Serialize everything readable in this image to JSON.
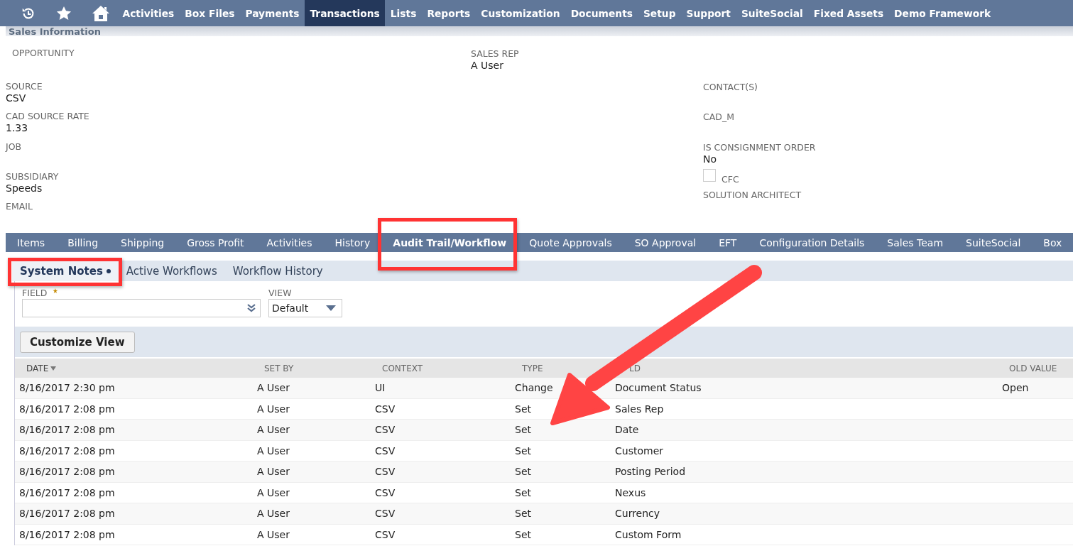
{
  "nav": {
    "icons": [
      {
        "kind": "history"
      },
      {
        "kind": "star"
      },
      {
        "kind": "home"
      }
    ],
    "items": [
      {
        "label": "Activities",
        "selected": false
      },
      {
        "label": "Box Files",
        "selected": false
      },
      {
        "label": "Payments",
        "selected": false
      },
      {
        "label": "Transactions",
        "selected": true
      },
      {
        "label": "Lists",
        "selected": false
      },
      {
        "label": "Reports",
        "selected": false
      },
      {
        "label": "Customization",
        "selected": false
      },
      {
        "label": "Documents",
        "selected": false
      },
      {
        "label": "Setup",
        "selected": false
      },
      {
        "label": "Support",
        "selected": false
      },
      {
        "label": "SuiteSocial",
        "selected": false
      },
      {
        "label": "Fixed Assets",
        "selected": false
      },
      {
        "label": "Demo Framework",
        "selected": false
      }
    ]
  },
  "section": {
    "title": "Sales Information"
  },
  "fields": {
    "column_1": [
      {
        "label": "OPPORTUNITY"
      },
      {
        "label": "SOURCE",
        "value": "CSV"
      },
      {
        "label": "CAD SOURCE RATE",
        "value": "1.33"
      },
      {
        "label": "JOB"
      },
      {
        "label": "SUBSIDIARY",
        "value": "Speeds"
      },
      {
        "label": "EMAIL"
      }
    ],
    "column_2": [
      {
        "label": "SALES REP",
        "value": "A User"
      }
    ],
    "column_3": [
      {
        "kind": "text",
        "label": "CONTACT(S)"
      },
      {
        "kind": "text",
        "label": "CAD_M"
      },
      {
        "kind": "text",
        "label": "IS CONSIGNMENT ORDER",
        "value": "No"
      },
      {
        "kind": "checkbox",
        "label": "CFC",
        "checked": false
      },
      {
        "kind": "text",
        "label": "SOLUTION ARCHITECT"
      }
    ]
  },
  "tabs": [
    {
      "label": "Items",
      "selected": false
    },
    {
      "label": "Billing",
      "selected": false
    },
    {
      "label": "Shipping",
      "selected": false
    },
    {
      "label": "Gross Profit",
      "selected": false
    },
    {
      "label": "Activities",
      "selected": false
    },
    {
      "label": "History",
      "selected": false
    },
    {
      "label": "Audit Trail/Workflow",
      "selected": true
    },
    {
      "label": "Quote Approvals",
      "selected": false
    },
    {
      "label": "SO Approval",
      "selected": false
    },
    {
      "label": "EFT",
      "selected": false
    },
    {
      "label": "Configuration Details",
      "selected": false
    },
    {
      "label": "Sales Team",
      "selected": false
    },
    {
      "label": "SuiteSocial",
      "selected": false
    },
    {
      "label": "Box",
      "selected": false
    }
  ],
  "subtabs": [
    {
      "label": "System Notes",
      "selected": true
    },
    {
      "label": "Active Workflows",
      "selected": false
    },
    {
      "label": "Workflow History",
      "selected": false
    }
  ],
  "filters": {
    "field": {
      "label": "FIELD",
      "required": true
    },
    "view": {
      "label": "VIEW",
      "value": "Default"
    }
  },
  "customize_button": "Customize View",
  "table": {
    "columns": [
      {
        "label": "DATE",
        "sorted": true
      },
      {
        "label": "SET BY",
        "sorted": false
      },
      {
        "label": "CONTEXT",
        "sorted": false
      },
      {
        "label": "TYPE",
        "sorted": false
      },
      {
        "label": "LD",
        "sorted": false
      },
      {
        "label": "OLD VALUE",
        "sorted": false
      }
    ],
    "rows": [
      [
        "8/16/2017 2:30 pm",
        "A User",
        "UI",
        "Change",
        "Document Status",
        "Open"
      ],
      [
        "8/16/2017 2:08 pm",
        "A User",
        "CSV",
        "Set",
        "Sales Rep",
        ""
      ],
      [
        "8/16/2017 2:08 pm",
        "A User",
        "CSV",
        "Set",
        "Date",
        ""
      ],
      [
        "8/16/2017 2:08 pm",
        "A User",
        "CSV",
        "Set",
        "Customer",
        ""
      ],
      [
        "8/16/2017 2:08 pm",
        "A User",
        "CSV",
        "Set",
        "Posting Period",
        ""
      ],
      [
        "8/16/2017 2:08 pm",
        "A User",
        "CSV",
        "Set",
        "Nexus",
        ""
      ],
      [
        "8/16/2017 2:08 pm",
        "A User",
        "CSV",
        "Set",
        "Currency",
        ""
      ],
      [
        "8/16/2017 2:08 pm",
        "A User",
        "CSV",
        "Set",
        "Custom Form",
        ""
      ]
    ]
  }
}
